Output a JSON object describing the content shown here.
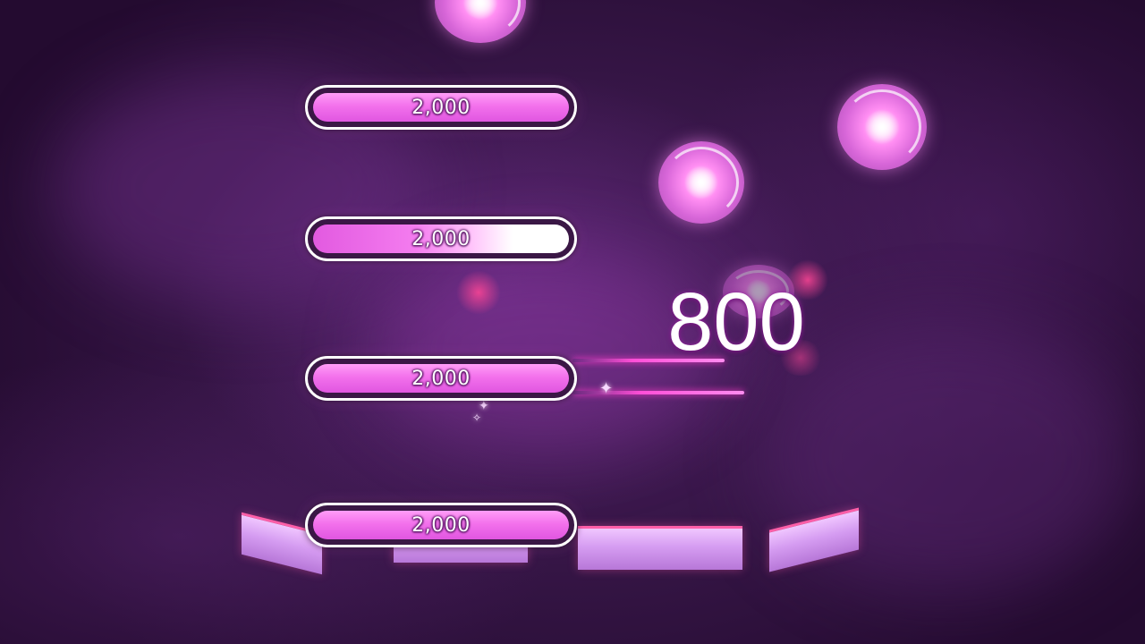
{
  "notes": [
    {
      "label": "2,000"
    },
    {
      "label": "2,000"
    },
    {
      "label": "2,000"
    },
    {
      "label": "2,000"
    }
  ],
  "score_popup": "800",
  "colors": {
    "background": "#351545",
    "note_fill": "#f371ec",
    "note_border": "#ffffff",
    "orb": "#ff8df2",
    "tile": "#d59cf1",
    "streak": "#ff4fd8"
  },
  "icons": {
    "orb": "sparkle-orb-icon",
    "sparkle": "sparkle-star-icon"
  }
}
